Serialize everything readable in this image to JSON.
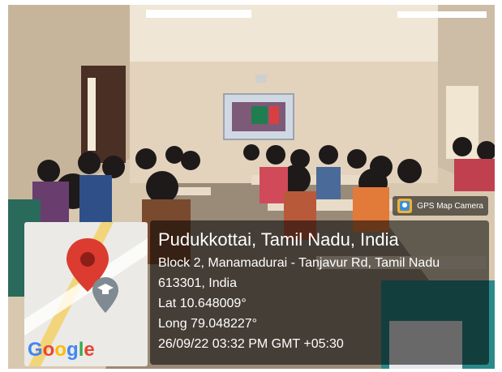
{
  "overlay": {
    "app_name": "GPS Map Camera",
    "location_title": "Pudukkottai, Tamil Nadu, India",
    "address_line1": "Block 2, Manamadurai - Tanjavur Rd, Tamil Nadu",
    "address_line2": "613301, India",
    "latitude": "Lat 10.648009°",
    "longitude": "Long 79.048227°",
    "timestamp": "26/09/22 03:32 PM GMT +05:30"
  },
  "map": {
    "brand": "Google"
  }
}
